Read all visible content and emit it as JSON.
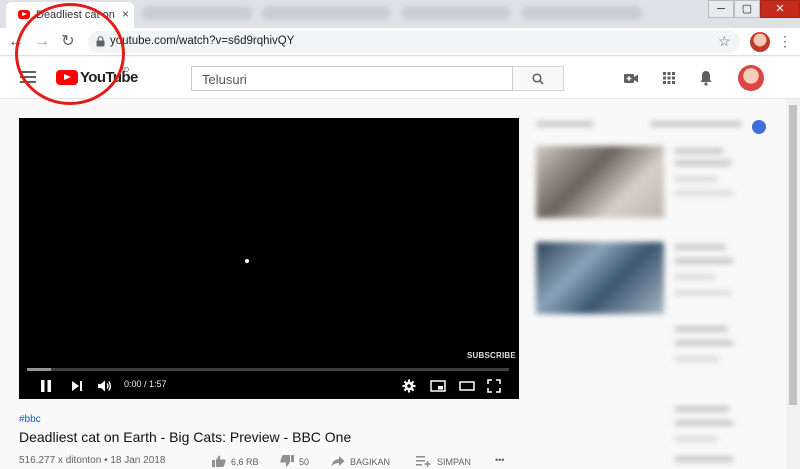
{
  "browser": {
    "tab_title": "Deadliest cat on Earth",
    "tab_close": "×",
    "window_min": "─",
    "window_max": "▢",
    "window_close": "✕",
    "back": "←",
    "forward": "→",
    "reload": "↻",
    "url": "youtube.com/watch?v=s6d9rqhivQY",
    "star": "☆",
    "menu": "⋮"
  },
  "masthead": {
    "logo_text": "YouTube",
    "logo_country": "ID",
    "search_placeholder": "Telusuri"
  },
  "player": {
    "watermark": "SUBSCRIBE",
    "time": "0:00 / 1:57",
    "loaded_fraction": 0.05
  },
  "video": {
    "hashtag": "#bbc",
    "title": "Deadliest cat on Earth - Big Cats: Preview - BBC One",
    "meta": "516.277 x ditonton • 18 Jan 2018",
    "likes": "6,6 RB",
    "dislikes": "50",
    "share_label": "BAGIKAN",
    "save_label": "SIMPAN",
    "more": "•••"
  },
  "colors": {
    "accent_red": "#ff0000",
    "annotation": "#e21b1b",
    "link_blue": "#065fd4"
  }
}
